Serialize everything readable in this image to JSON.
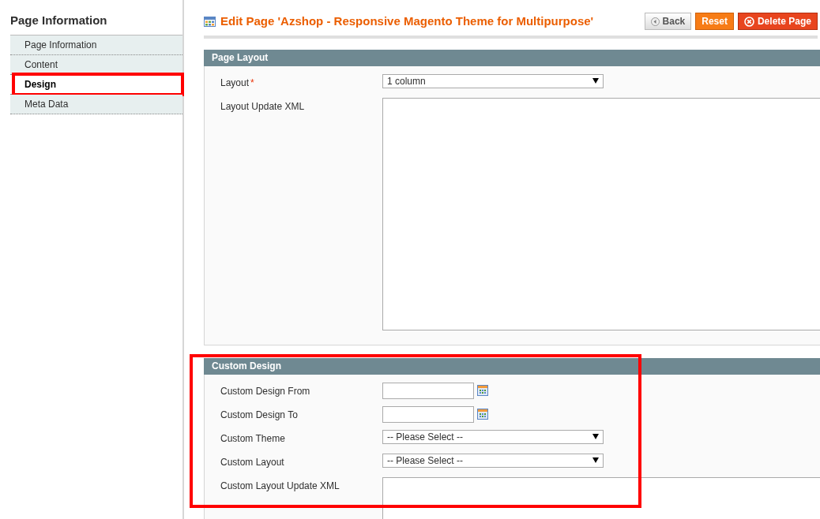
{
  "sidebar": {
    "title": "Page Information",
    "items": [
      {
        "label": "Page Information",
        "selected": false,
        "highlighted": false
      },
      {
        "label": "Content",
        "selected": false,
        "highlighted": false
      },
      {
        "label": "Design",
        "selected": true,
        "highlighted": true
      },
      {
        "label": "Meta Data",
        "selected": false,
        "highlighted": false
      }
    ]
  },
  "header": {
    "title": "Edit Page 'Azshop - Responsive Magento Theme for Multipurpose'",
    "buttons": [
      {
        "label": "Back",
        "kind": "back"
      },
      {
        "label": "Reset",
        "kind": "reset"
      },
      {
        "label": "Delete Page",
        "kind": "delete"
      }
    ]
  },
  "fieldsets": [
    {
      "title": "Page Layout",
      "highlighted": false,
      "fields": [
        {
          "label": "Layout",
          "required_mark": "*",
          "kind": "select",
          "value": "1 column"
        },
        {
          "label": "Layout Update XML",
          "kind": "textarea"
        }
      ]
    },
    {
      "title": "Custom Design",
      "highlighted": true,
      "fields": [
        {
          "label": "Custom Design From",
          "kind": "date"
        },
        {
          "label": "Custom Design To",
          "kind": "date"
        },
        {
          "label": "Custom Theme",
          "kind": "select",
          "value": "-- Please Select --"
        },
        {
          "label": "Custom Layout",
          "kind": "select",
          "value": "-- Please Select --"
        },
        {
          "label": "Custom Layout Update XML",
          "kind": "textarea-short"
        }
      ]
    }
  ]
}
